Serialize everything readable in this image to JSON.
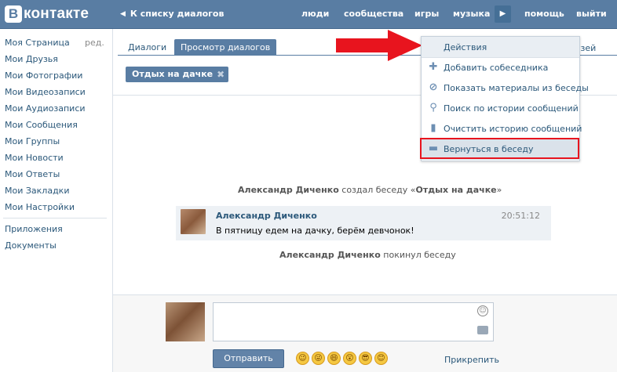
{
  "header": {
    "logo_letter": "В",
    "logo_text": "контакте",
    "back_label": "К списку диалогов",
    "nav": [
      "люди",
      "сообщества",
      "игры",
      "музыка",
      "помощь",
      "выйти"
    ]
  },
  "left_menu": {
    "items": [
      "Моя Страница",
      "Мои Друзья",
      "Мои Фотографии",
      "Мои Видеозаписи",
      "Мои Аудиозаписи",
      "Мои Сообщения",
      "Мои Группы",
      "Мои Новости",
      "Мои Ответы",
      "Мои Закладки",
      "Мои Настройки"
    ],
    "edit_label": "ред.",
    "extra_items": [
      "Приложения",
      "Документы"
    ]
  },
  "tabs": {
    "dialogs": "Диалоги",
    "view": "Просмотр диалогов",
    "friends_fragment": "узей"
  },
  "conversation": {
    "title": "Отдых на дачке",
    "created": {
      "name": "Александр Диченко",
      "text": " создал беседу «",
      "title": "Отдых на дачке",
      "end": "»"
    },
    "message": {
      "author": "Александр Диченко",
      "time": "20:51:12",
      "text": "В пятницу едем на дачку, берём девчонок!"
    },
    "left": {
      "name": "Александр Диченко",
      "text": " покинул беседу"
    }
  },
  "composer": {
    "send_label": "Отправить",
    "attach_label": "Прикрепить",
    "emojis": [
      "😉",
      "😜",
      "😄",
      "😲",
      "😎",
      "😊"
    ]
  },
  "dropdown": {
    "header": "Действия",
    "items": [
      {
        "label": "Добавить собеседника",
        "icon": "plus-icon"
      },
      {
        "label": "Показать материалы из беседы",
        "icon": "paperclip-icon"
      },
      {
        "label": "Поиск по истории сообщений",
        "icon": "search-icon"
      },
      {
        "label": "Очистить историю сообщений",
        "icon": "trash-icon"
      },
      {
        "label": "Вернуться в беседу",
        "icon": "chat-bubble-icon"
      }
    ]
  },
  "colors": {
    "brand": "#597da3",
    "link": "#2b587a",
    "highlight": "#e8141e"
  }
}
